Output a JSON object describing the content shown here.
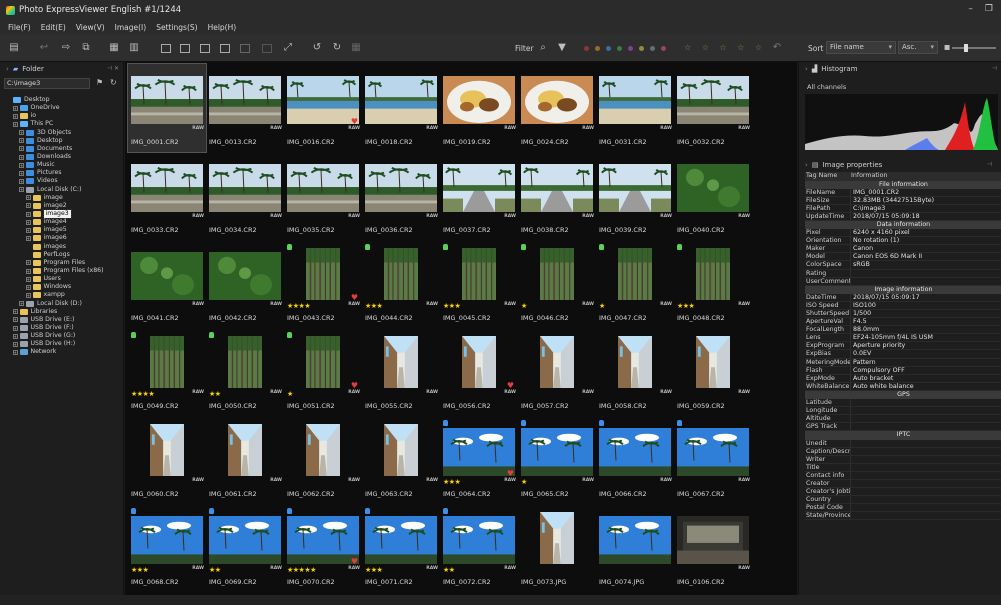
{
  "window": {
    "title": "Photo ExpressViewer English  #1/1244",
    "minimize": "–",
    "restore": "❐"
  },
  "menu": [
    "File(F)",
    "Edit(E)",
    "View(V)",
    "Image(I)",
    "Settings(S)",
    "Help(H)"
  ],
  "toolbar": {
    "filter_label": "Filter",
    "sort_label": "Sort",
    "sort_field": "File name",
    "sort_order": "Asc.",
    "dot_colors": [
      "#e03a3a",
      "#f0a020",
      "#4aa3f0",
      "#3ec24a",
      "#c94de0",
      "#e8d84a",
      "#9aa0a6",
      "#e85a9a"
    ],
    "star_filter": "☆ ☆ ☆ ☆ ☆"
  },
  "folder_panel": {
    "title": "Folder",
    "path": "C:\\image3",
    "tree": [
      {
        "label": "Desktop",
        "depth": 0,
        "icon": "pc",
        "exp": false
      },
      {
        "label": "OneDrive",
        "depth": 1,
        "icon": "cloud",
        "exp": true
      },
      {
        "label": "io",
        "depth": 1,
        "icon": "folder",
        "exp": true
      },
      {
        "label": "This PC",
        "depth": 1,
        "icon": "pc",
        "exp": true
      },
      {
        "label": "3D Objects",
        "depth": 2,
        "icon": "blue",
        "exp": true
      },
      {
        "label": "Desktop",
        "depth": 2,
        "icon": "blue",
        "exp": true
      },
      {
        "label": "Documents",
        "depth": 2,
        "icon": "blue",
        "exp": true
      },
      {
        "label": "Downloads",
        "depth": 2,
        "icon": "blue",
        "exp": true
      },
      {
        "label": "Music",
        "depth": 2,
        "icon": "blue",
        "exp": true
      },
      {
        "label": "Pictures",
        "depth": 2,
        "icon": "blue",
        "exp": true
      },
      {
        "label": "Videos",
        "depth": 2,
        "icon": "blue",
        "exp": true
      },
      {
        "label": "Local Disk (C:)",
        "depth": 2,
        "icon": "drive",
        "exp": true
      },
      {
        "label": "image",
        "depth": 3,
        "icon": "folder",
        "exp": true
      },
      {
        "label": "image2",
        "depth": 3,
        "icon": "folder",
        "exp": true
      },
      {
        "label": "image3",
        "depth": 3,
        "icon": "folder",
        "exp": true,
        "selected": true
      },
      {
        "label": "image4",
        "depth": 3,
        "icon": "folder",
        "exp": true
      },
      {
        "label": "image5",
        "depth": 3,
        "icon": "folder",
        "exp": true
      },
      {
        "label": "image6",
        "depth": 3,
        "icon": "folder",
        "exp": true
      },
      {
        "label": "images",
        "depth": 3,
        "icon": "folder",
        "exp": false
      },
      {
        "label": "PerfLogs",
        "depth": 3,
        "icon": "folder",
        "exp": false
      },
      {
        "label": "Program Files",
        "depth": 3,
        "icon": "folder",
        "exp": true
      },
      {
        "label": "Program Files (x86)",
        "depth": 3,
        "icon": "folder",
        "exp": true
      },
      {
        "label": "Users",
        "depth": 3,
        "icon": "folder",
        "exp": true
      },
      {
        "label": "Windows",
        "depth": 3,
        "icon": "folder",
        "exp": true
      },
      {
        "label": "xampp",
        "depth": 3,
        "icon": "folder",
        "exp": true
      },
      {
        "label": "Local Disk (D:)",
        "depth": 2,
        "icon": "drive",
        "exp": true
      },
      {
        "label": "Libraries",
        "depth": 1,
        "icon": "folder",
        "exp": true
      },
      {
        "label": "USB Drive (E:)",
        "depth": 1,
        "icon": "drive",
        "exp": true
      },
      {
        "label": "USB Drive (F:)",
        "depth": 1,
        "icon": "drive",
        "exp": true
      },
      {
        "label": "USB Drive (G:)",
        "depth": 1,
        "icon": "drive",
        "exp": true
      },
      {
        "label": "USB Drive (H:)",
        "depth": 1,
        "icon": "drive",
        "exp": true
      },
      {
        "label": "Network",
        "depth": 1,
        "icon": "net",
        "exp": true
      }
    ]
  },
  "thumbnails": [
    {
      "name": "IMG_0001.CR2",
      "scene": "palm",
      "selected": true,
      "raw": true
    },
    {
      "name": "IMG_0013.CR2",
      "scene": "palm",
      "raw": true
    },
    {
      "name": "IMG_0016.CR2",
      "scene": "beach",
      "heart": true,
      "raw": true
    },
    {
      "name": "IMG_0018.CR2",
      "scene": "beach",
      "raw": true
    },
    {
      "name": "IMG_0019.CR2",
      "scene": "food",
      "raw": true
    },
    {
      "name": "IMG_0024.CR2",
      "scene": "food",
      "raw": true
    },
    {
      "name": "IMG_0031.CR2",
      "scene": "beach",
      "raw": true
    },
    {
      "name": "IMG_0032.CR2",
      "scene": "palm",
      "raw": true
    },
    {
      "name": "IMG_0033.CR2",
      "scene": "palm",
      "raw": true
    },
    {
      "name": "IMG_0034.CR2",
      "scene": "palm",
      "raw": true
    },
    {
      "name": "IMG_0035.CR2",
      "scene": "palm",
      "raw": true
    },
    {
      "name": "IMG_0036.CR2",
      "scene": "palm",
      "raw": true
    },
    {
      "name": "IMG_0037.CR2",
      "scene": "road",
      "raw": true
    },
    {
      "name": "IMG_0038.CR2",
      "scene": "road",
      "raw": true
    },
    {
      "name": "IMG_0039.CR2",
      "scene": "road",
      "raw": true
    },
    {
      "name": "IMG_0040.CR2",
      "scene": "grass",
      "raw": true
    },
    {
      "name": "IMG_0041.CR2",
      "scene": "grass",
      "raw": true
    },
    {
      "name": "IMG_0042.CR2",
      "scene": "grass",
      "raw": true
    },
    {
      "name": "IMG_0043.CR2",
      "scene": "banyan",
      "tag": "g",
      "stars": "★★★★",
      "heart": true,
      "raw": true
    },
    {
      "name": "IMG_0044.CR2",
      "scene": "banyan",
      "tag": "g",
      "stars": "★★★",
      "raw": true
    },
    {
      "name": "IMG_0045.CR2",
      "scene": "banyan",
      "tag": "g",
      "stars": "★★★",
      "raw": true
    },
    {
      "name": "IMG_0046.CR2",
      "scene": "banyan",
      "tag": "g",
      "stars": "★",
      "raw": true
    },
    {
      "name": "IMG_0047.CR2",
      "scene": "banyan",
      "tag": "g",
      "stars": "★",
      "raw": true
    },
    {
      "name": "IMG_0048.CR2",
      "scene": "banyan",
      "tag": "g",
      "stars": "★★★",
      "raw": true
    },
    {
      "name": "IMG_0049.CR2",
      "scene": "banyan",
      "tag": "g",
      "stars": "★★★★",
      "raw": true
    },
    {
      "name": "IMG_0050.CR2",
      "scene": "banyan",
      "tag": "g",
      "stars": "★★",
      "raw": true
    },
    {
      "name": "IMG_0051.CR2",
      "scene": "banyan",
      "tag": "g",
      "stars": "★",
      "heart": true,
      "raw": true
    },
    {
      "name": "IMG_0055.CR2",
      "scene": "alley",
      "raw": true
    },
    {
      "name": "IMG_0056.CR2",
      "scene": "alley",
      "heart": true,
      "raw": true
    },
    {
      "name": "IMG_0057.CR2",
      "scene": "alley",
      "raw": true
    },
    {
      "name": "IMG_0058.CR2",
      "scene": "alley",
      "raw": true
    },
    {
      "name": "IMG_0059.CR2",
      "scene": "alley",
      "raw": true
    },
    {
      "name": "IMG_0060.CR2",
      "scene": "alley",
      "raw": true
    },
    {
      "name": "IMG_0061.CR2",
      "scene": "alley",
      "raw": true
    },
    {
      "name": "IMG_0062.CR2",
      "scene": "alley",
      "raw": true
    },
    {
      "name": "IMG_0063.CR2",
      "scene": "alley",
      "raw": true
    },
    {
      "name": "IMG_0064.CR2",
      "scene": "sky",
      "tag": "b",
      "stars": "★★★",
      "heart": true,
      "raw": true
    },
    {
      "name": "IMG_0065.CR2",
      "scene": "sky",
      "tag": "b",
      "stars": "★",
      "raw": true
    },
    {
      "name": "IMG_0066.CR2",
      "scene": "sky",
      "tag": "b",
      "raw": true
    },
    {
      "name": "IMG_0067.CR2",
      "scene": "sky",
      "tag": "b",
      "raw": true
    },
    {
      "name": "IMG_0068.CR2",
      "scene": "sky",
      "tag": "b",
      "stars": "★★★",
      "raw": true
    },
    {
      "name": "IMG_0069.CR2",
      "scene": "sky",
      "tag": "b",
      "stars": "★★",
      "raw": true
    },
    {
      "name": "IMG_0070.CR2",
      "scene": "sky",
      "tag": "b",
      "stars": "★★★★★",
      "heart": true,
      "raw": true
    },
    {
      "name": "IMG_0071.CR2",
      "scene": "sky",
      "tag": "b",
      "stars": "★★★",
      "raw": true
    },
    {
      "name": "IMG_0072.CR2",
      "scene": "sky",
      "tag": "b",
      "stars": "★★",
      "raw": true
    },
    {
      "name": "IMG_0073.JPG",
      "scene": "alley"
    },
    {
      "name": "IMG_0074.JPG",
      "scene": "sky"
    },
    {
      "name": "IMG_0106.CR2",
      "scene": "room",
      "raw": true
    }
  ],
  "raw_badge": "RAW",
  "heart_glyph": "♥",
  "histogram": {
    "title": "Histogram",
    "channel_label": "All channels"
  },
  "properties": {
    "title": "Image properties",
    "col_tag": "Tag Name",
    "col_info": "Information",
    "rows": [
      {
        "section": "File information"
      },
      {
        "k": "FileName",
        "v": "IMG_0001.CR2"
      },
      {
        "k": "FileSize",
        "v": "32.83MB (34427515Byte)"
      },
      {
        "k": "FilePath",
        "v": "C:\\image3"
      },
      {
        "k": "UpdateTime",
        "v": "2018/07/15 05:09:18"
      },
      {
        "section": "Data information"
      },
      {
        "k": "Pixel",
        "v": "6240 x 4160 pixel"
      },
      {
        "k": "Orientation",
        "v": "No rotation (1)"
      },
      {
        "k": "Maker",
        "v": "Canon"
      },
      {
        "k": "Model",
        "v": "Canon EOS 6D Mark II"
      },
      {
        "k": "ColorSpace",
        "v": "sRGB"
      },
      {
        "k": "Rating",
        "v": ""
      },
      {
        "k": "UserComment",
        "v": ""
      },
      {
        "section": "Image information"
      },
      {
        "k": "DateTime",
        "v": "2018/07/15 05:09:17"
      },
      {
        "k": "ISO Speed",
        "v": "ISO100"
      },
      {
        "k": "ShutterSpeed",
        "v": "1/500"
      },
      {
        "k": "ApertureVal",
        "v": "F4.5"
      },
      {
        "k": "FocalLength",
        "v": "88.0mm"
      },
      {
        "k": "Lens",
        "v": "EF24-105mm f/4L IS USM"
      },
      {
        "k": "ExpProgram",
        "v": "Aperture priority"
      },
      {
        "k": "ExpBias",
        "v": "0.0EV"
      },
      {
        "k": "MeteringMode",
        "v": "Pattern"
      },
      {
        "k": "Flash",
        "v": "Compulsory OFF"
      },
      {
        "k": "ExpMode",
        "v": "Auto bracket"
      },
      {
        "k": "WhiteBalance",
        "v": "Auto white balance"
      },
      {
        "section": "GPS"
      },
      {
        "k": "Latitude",
        "v": ""
      },
      {
        "k": "Longitude",
        "v": ""
      },
      {
        "k": "Altitude",
        "v": ""
      },
      {
        "k": "GPS Track",
        "v": ""
      },
      {
        "section": "IPTC"
      },
      {
        "k": "Unedit",
        "v": ""
      },
      {
        "k": "Caption/Descri",
        "v": ""
      },
      {
        "k": "Writer",
        "v": ""
      },
      {
        "k": "Title",
        "v": ""
      },
      {
        "k": "Contact info",
        "v": ""
      },
      {
        "k": "Creator",
        "v": ""
      },
      {
        "k": "Creator's Jobtit",
        "v": ""
      },
      {
        "k": "Country",
        "v": ""
      },
      {
        "k": "Postal Code",
        "v": ""
      },
      {
        "k": "State/Province",
        "v": ""
      }
    ]
  }
}
